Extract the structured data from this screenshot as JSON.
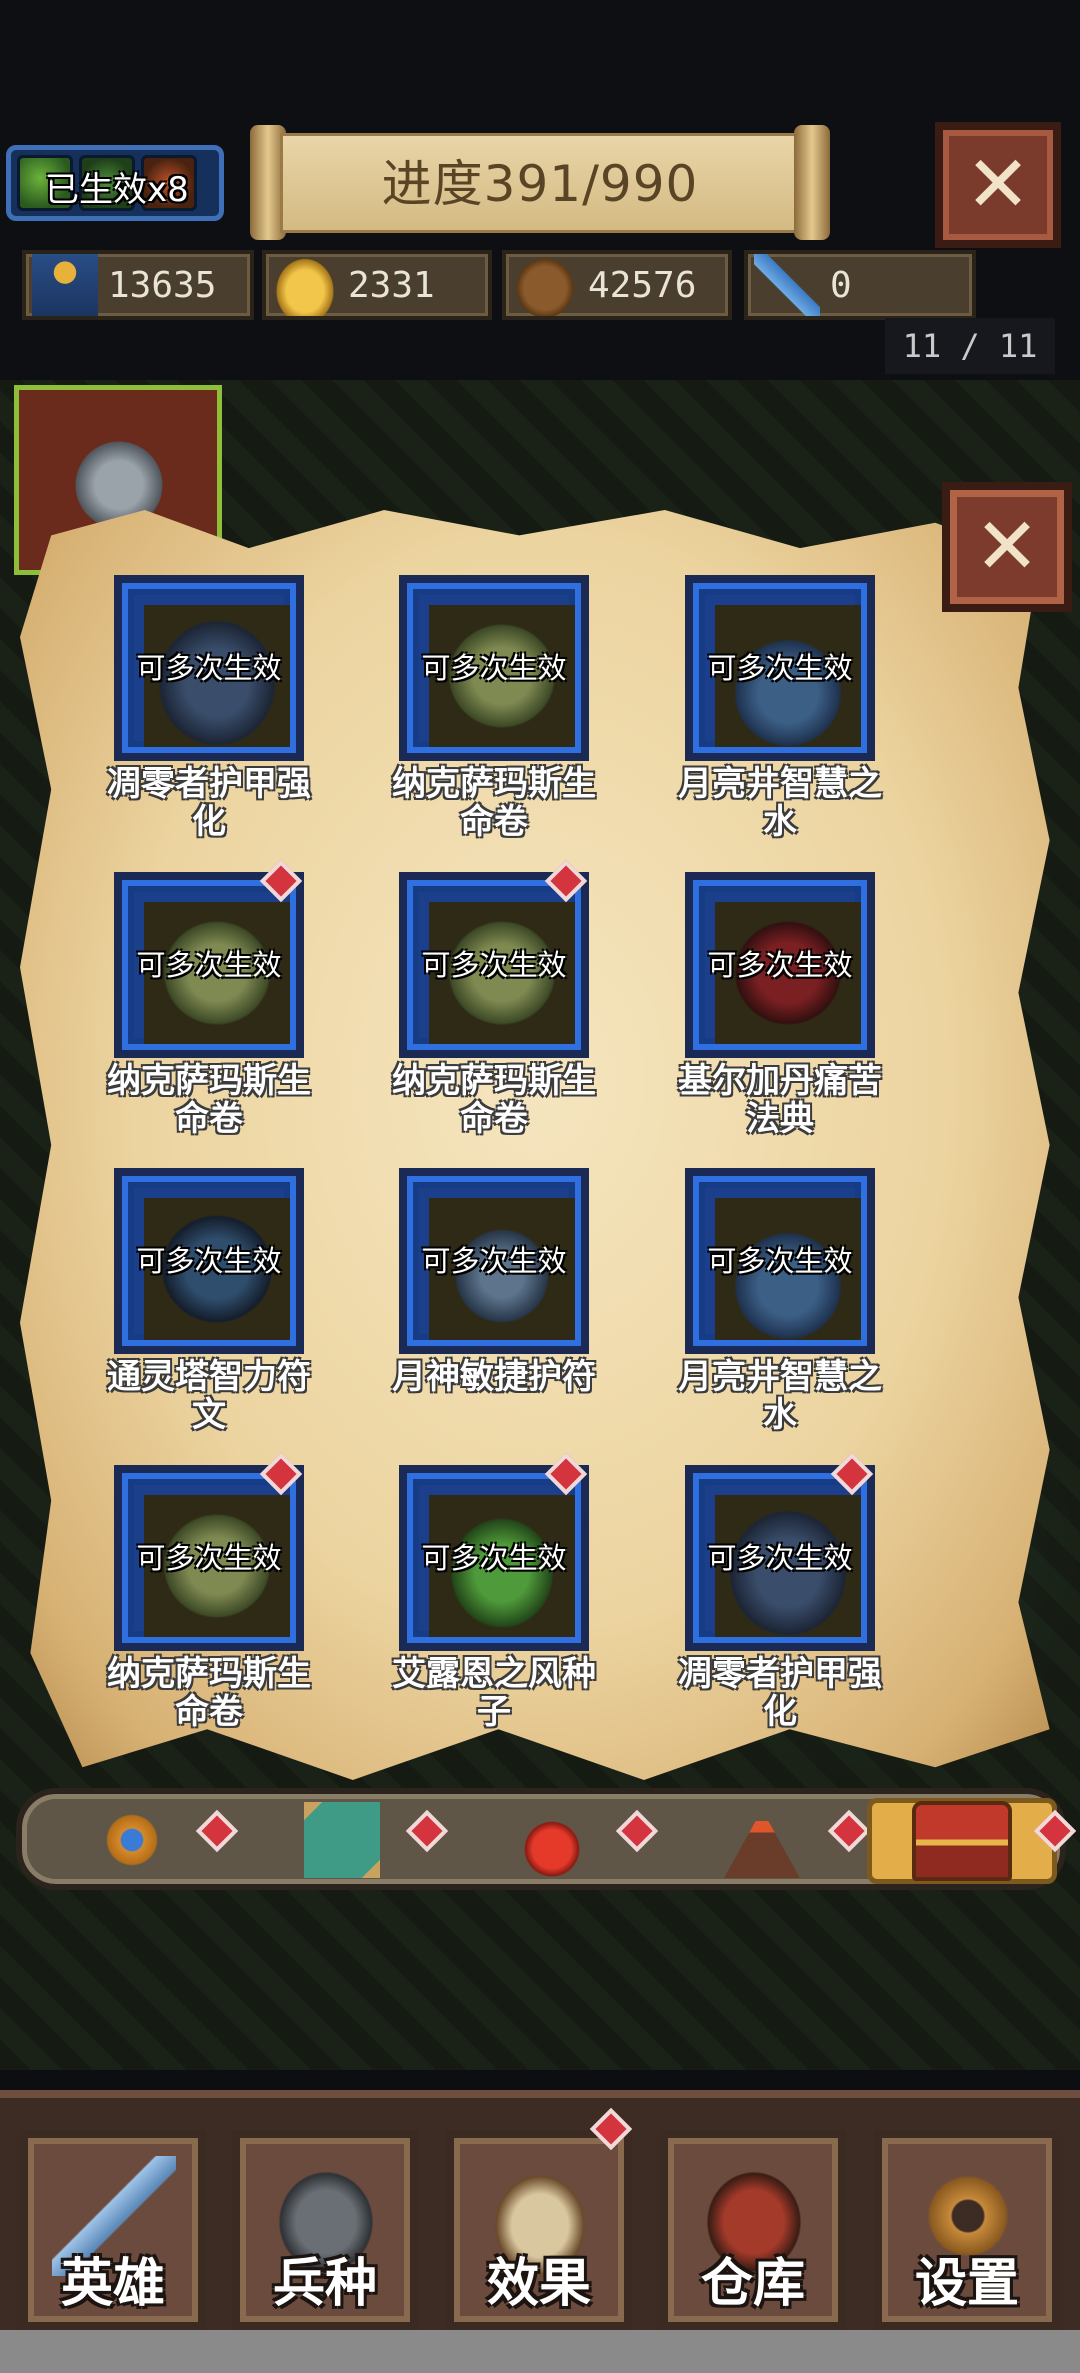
{
  "hud": {
    "effect_badge": "已生效x8",
    "progress": "进度391/990",
    "resources": [
      {
        "icon": "population-icon",
        "value": "13635"
      },
      {
        "icon": "gold-coins-icon",
        "value": "2331"
      },
      {
        "icon": "wood-logs-icon",
        "value": "42576"
      },
      {
        "icon": "blue-key-icon",
        "value": "0"
      }
    ],
    "wave_counter": "11 / 11"
  },
  "panel": {
    "items": [
      {
        "tag": "可多次生效",
        "name": "凋零者护甲强化",
        "icon": "armor",
        "dot": false
      },
      {
        "tag": "可多次生效",
        "name": "纳克萨玛斯生命卷",
        "icon": "scroll",
        "dot": false
      },
      {
        "tag": "可多次生效",
        "name": "月亮井智慧之水",
        "icon": "moon-urn",
        "dot": false
      },
      {
        "tag": "可多次生效",
        "name": "纳克萨玛斯生命卷",
        "icon": "scroll",
        "dot": true
      },
      {
        "tag": "可多次生效",
        "name": "纳克萨玛斯生命卷",
        "icon": "scroll",
        "dot": true
      },
      {
        "tag": "可多次生效",
        "name": "基尔加丹痛苦法典",
        "icon": "dark-book",
        "dot": false
      },
      {
        "tag": "可多次生效",
        "name": "通灵塔智力符文",
        "icon": "rune",
        "dot": false
      },
      {
        "tag": "可多次生效",
        "name": "月神敏捷护符",
        "icon": "amulet",
        "dot": false
      },
      {
        "tag": "可多次生效",
        "name": "月亮井智慧之水",
        "icon": "moon-urn",
        "dot": false
      },
      {
        "tag": "可多次生效",
        "name": "纳克萨玛斯生命卷",
        "icon": "scroll",
        "dot": true
      },
      {
        "tag": "可多次生效",
        "name": "艾露恩之风种子",
        "icon": "seed",
        "dot": true
      },
      {
        "tag": "可多次生效",
        "name": "凋零者护甲强化",
        "icon": "armor",
        "dot": true
      }
    ]
  },
  "tabs": [
    {
      "icon": "gear-gem-icon",
      "dot": true
    },
    {
      "icon": "treasure-map-icon",
      "dot": true
    },
    {
      "icon": "red-potion-icon",
      "dot": true
    },
    {
      "icon": "volcano-icon",
      "dot": true
    },
    {
      "icon": "treasure-chest-icon",
      "dot": true,
      "selected": true
    }
  ],
  "bottom_nav": [
    {
      "label": "英雄",
      "icon": "sword-icon"
    },
    {
      "label": "兵种",
      "icon": "helmet-icon"
    },
    {
      "label": "效果",
      "icon": "spellbook-icon",
      "dot": true
    },
    {
      "label": "仓库",
      "icon": "chest-icon"
    },
    {
      "label": "设置",
      "icon": "gear-icon"
    }
  ]
}
